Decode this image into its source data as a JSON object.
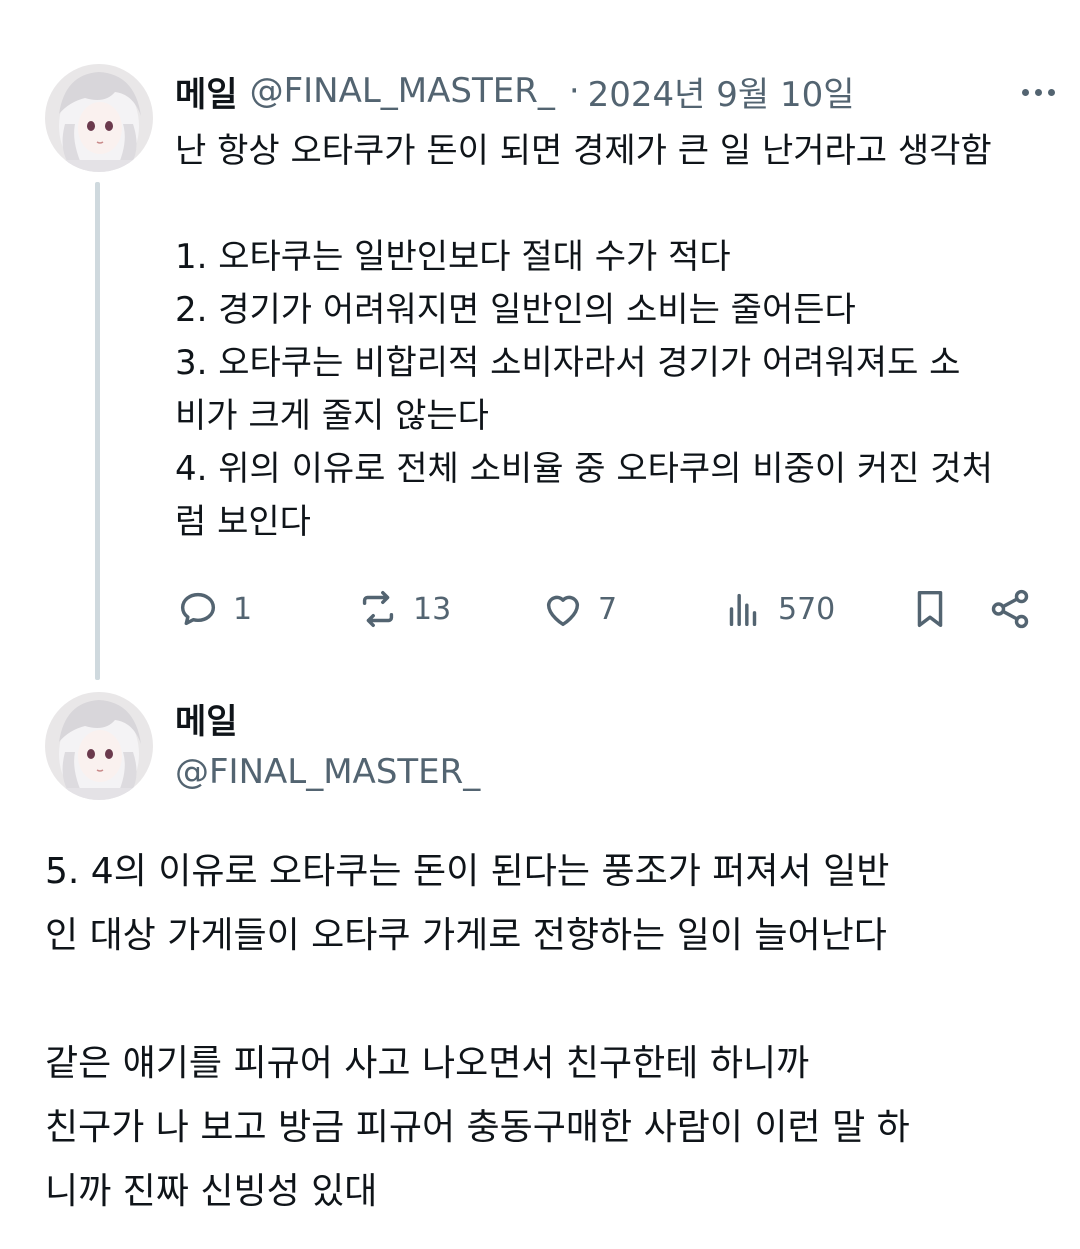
{
  "thread_parent": {
    "display_name": "메일",
    "handle": "@FINAL_MASTER_",
    "separator": "·",
    "date": "2024년 9월 10일",
    "lines": [
      "난 항상 오타쿠가 돈이 되면 경제가 큰 일 난거라고 생각함",
      "",
      "1. 오타쿠는 일반인보다 절대 수가 적다",
      "2. 경기가 어려워지면 일반인의 소비는 줄어든다",
      "3. 오타쿠는 비합리적 소비자라서 경기가 어려워져도 소",
      "비가 크게 줄지 않는다",
      "4. 위의 이유로 전체 소비율 중 오타쿠의 비중이 커진 것처",
      "럼 보인다"
    ],
    "stats": {
      "replies": "1",
      "retweets": "13",
      "likes": "7",
      "views": "570"
    },
    "icons": {
      "reply": "speech-bubble-icon",
      "retweet": "retweet-icon",
      "like": "heart-icon",
      "views": "bar-chart-icon",
      "bookmark": "bookmark-icon",
      "share": "share-icon",
      "more": "more-dots-icon"
    }
  },
  "thread_reply": {
    "display_name": "메일",
    "handle": "@FINAL_MASTER_",
    "lines": [
      "5. 4의 이유로 오타쿠는 돈이 된다는 풍조가 퍼져서 일반",
      "인 대상 가게들이 오타쿠 가게로 전향하는 일이 늘어난다",
      "",
      "같은 얘기를 피규어 사고 나오면서 친구한테 하니까",
      "친구가 나 보고 방금 피규어 충동구매한 사람이 이런 말 하",
      "니까 진짜 신빙성 있대"
    ]
  },
  "colors": {
    "text_primary": "#0f1419",
    "text_secondary": "#536471",
    "thread_line": "#cfd9de"
  }
}
